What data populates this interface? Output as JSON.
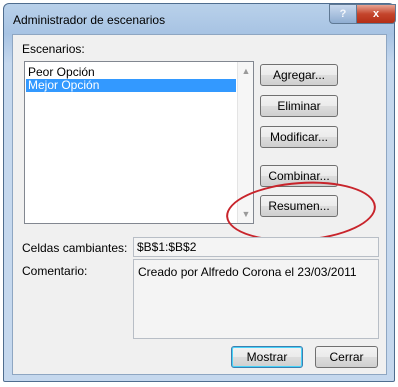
{
  "window": {
    "title": "Administrador de escenarios",
    "help_glyph": "?",
    "close_glyph": "x"
  },
  "scenarios": {
    "label": "Escenarios:",
    "items": [
      "Peor Opción",
      "Mejor Opción"
    ],
    "selected_index": 1
  },
  "buttons": {
    "add": "Agregar...",
    "delete": "Eliminar",
    "modify": "Modificar...",
    "combine": "Combinar...",
    "summary": "Resumen...",
    "show": "Mostrar",
    "close": "Cerrar"
  },
  "changing_cells": {
    "label": "Celdas cambiantes:",
    "value": "$B$1:$B$2"
  },
  "comment": {
    "label": "Comentario:",
    "value": "Creado por Alfredo Corona el 23/03/2011"
  },
  "icons": {
    "scroll_up": "triangle-up",
    "scroll_down": "triangle-down"
  },
  "colors": {
    "selection": "#3399ff",
    "highlight_ellipse": "#c8242b",
    "close_button": "#c4452c"
  }
}
